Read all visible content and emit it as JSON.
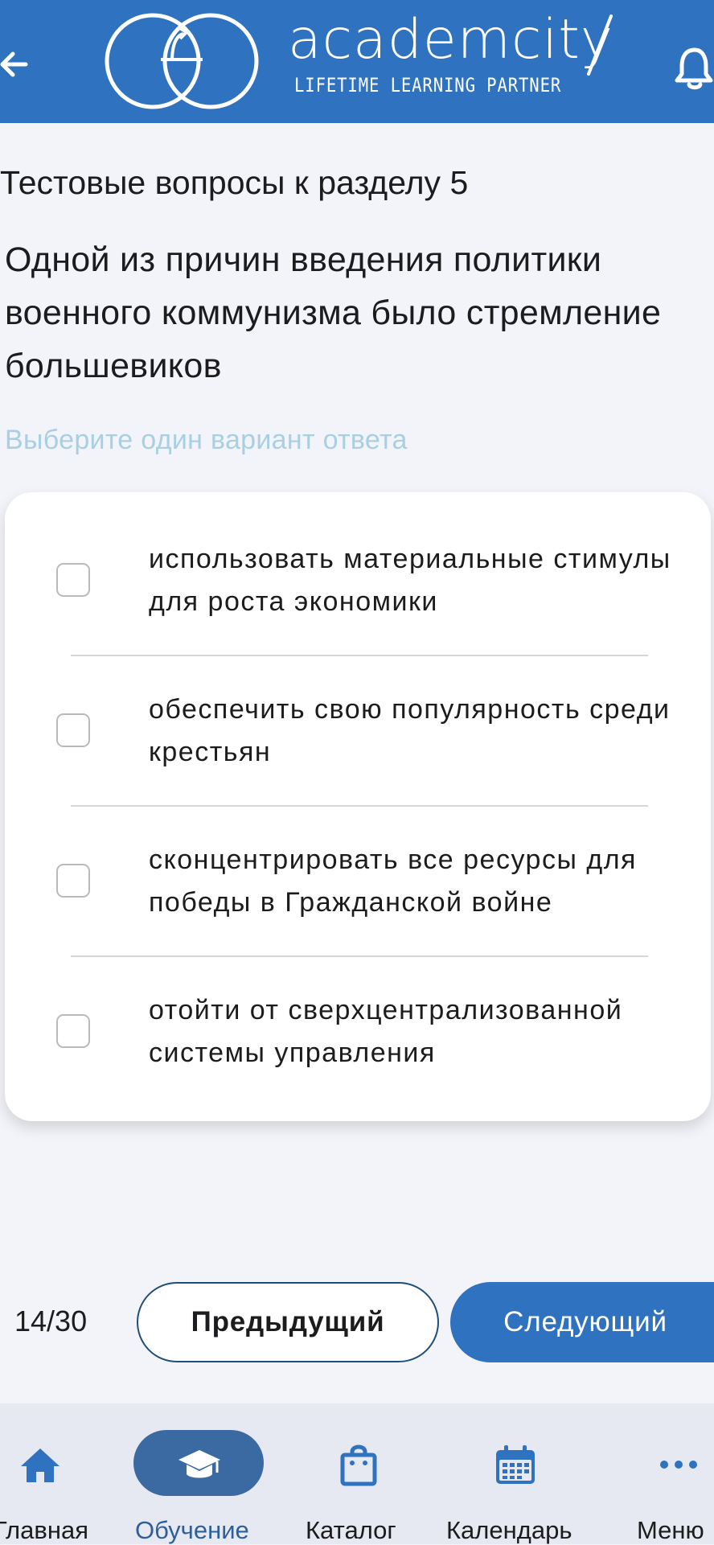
{
  "header": {
    "brand_name": "academcity",
    "brand_tagline": "LIFETIME LEARNING PARTNER",
    "icons": {
      "back": "arrow-left-icon",
      "logo": "academcity-logo-icon",
      "notifications": "bell-icon"
    }
  },
  "quiz": {
    "section_title": "Тестовые вопросы к разделу 5",
    "question": "Одной из причин введения политики военного коммунизма было стремление большевиков",
    "hint": "Выберите один вариант ответа",
    "options": [
      {
        "label": "использовать материальные стимулы для роста экономики",
        "checked": false
      },
      {
        "label": "обеспечить свою популярность среди крестьян",
        "checked": false
      },
      {
        "label": "сконцентрировать все ресурсы для победы в Гражданской войне",
        "checked": false
      },
      {
        "label": "отойти от сверхцентрализованной системы управления",
        "checked": false
      }
    ]
  },
  "pagination": {
    "counter": "14/30",
    "prev_label": "Предыдущий",
    "next_label": "Следующий"
  },
  "nav": {
    "items": [
      {
        "label": "Главная",
        "icon": "home-icon",
        "active": false
      },
      {
        "label": "Обучение",
        "icon": "graduation-cap-icon",
        "active": true
      },
      {
        "label": "Каталог",
        "icon": "shopping-bag-icon",
        "active": false
      },
      {
        "label": "Календарь",
        "icon": "calendar-icon",
        "active": false
      },
      {
        "label": "Меню",
        "icon": "more-dots-icon",
        "active": false
      }
    ]
  },
  "colors": {
    "brand_blue": "#2f72bf",
    "active_tab": "#3b6aa3",
    "hint_text": "#a8cfe2",
    "background": "#f3f4f9",
    "tabbar_bg": "#e7e9f2"
  }
}
